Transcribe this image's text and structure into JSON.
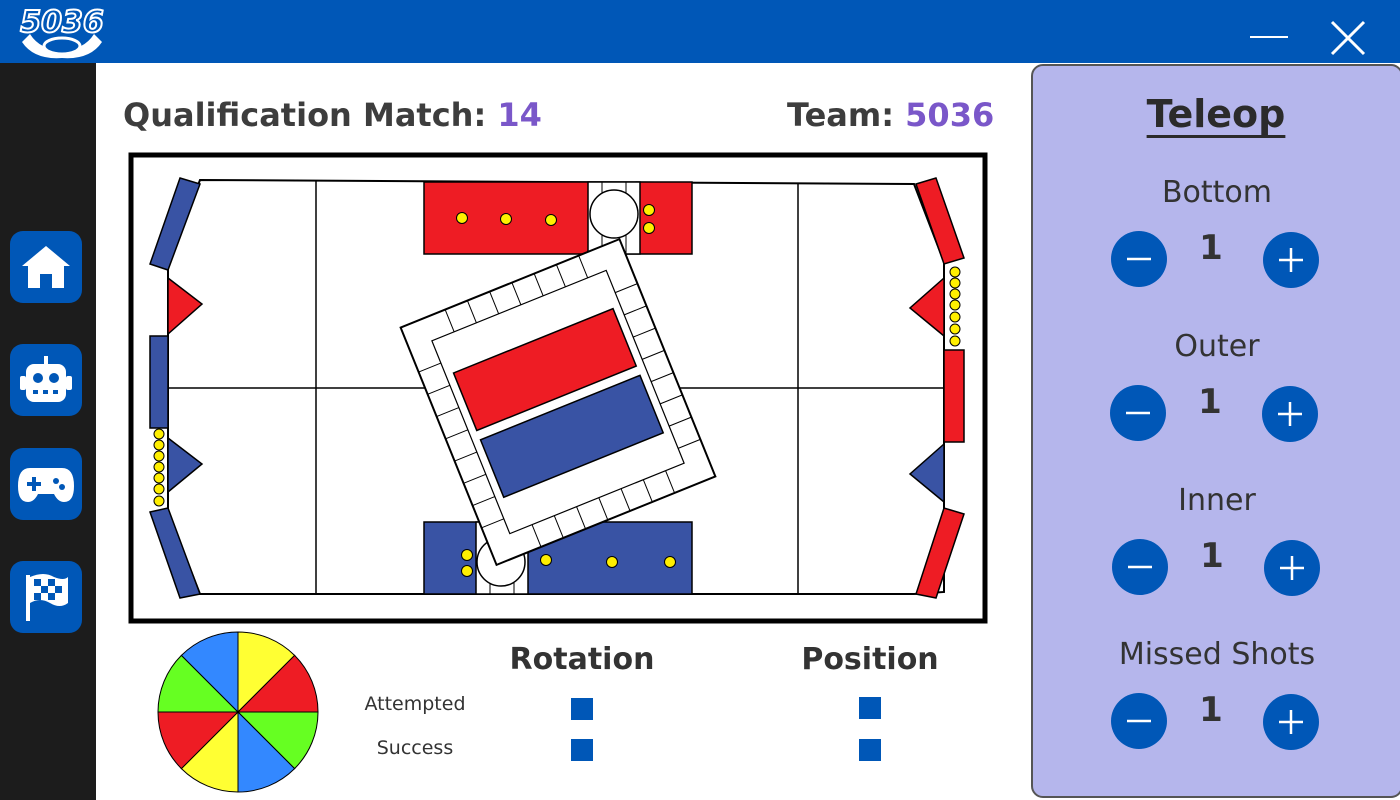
{
  "app": {
    "logo_text": "5036"
  },
  "window": {
    "minimize_icon": "minimize-icon",
    "close_icon": "close-icon"
  },
  "sidebar": {
    "items": [
      {
        "icon": "home-icon"
      },
      {
        "icon": "robot-icon"
      },
      {
        "icon": "gamepad-icon"
      },
      {
        "icon": "checkered-flag-icon"
      }
    ]
  },
  "header": {
    "match_label": "Qualification Match: ",
    "match_number": "14",
    "team_label": "Team: ",
    "team_number": "5036"
  },
  "colors": {
    "accent": "#0057b7",
    "highlight": "#7a57c9",
    "panel": "#b5b6ec",
    "red_alliance": "#ee1c24",
    "blue_alliance": "#3953a4"
  },
  "control_panel": {
    "columns": [
      "Rotation",
      "Position"
    ],
    "rows": [
      "Attempted",
      "Success"
    ]
  },
  "teleop": {
    "title": "Teleop",
    "counters": [
      {
        "label": "Bottom",
        "value": "1"
      },
      {
        "label": "Outer",
        "value": "1"
      },
      {
        "label": "Inner",
        "value": "1"
      },
      {
        "label": "Missed Shots",
        "value": "1"
      }
    ]
  }
}
